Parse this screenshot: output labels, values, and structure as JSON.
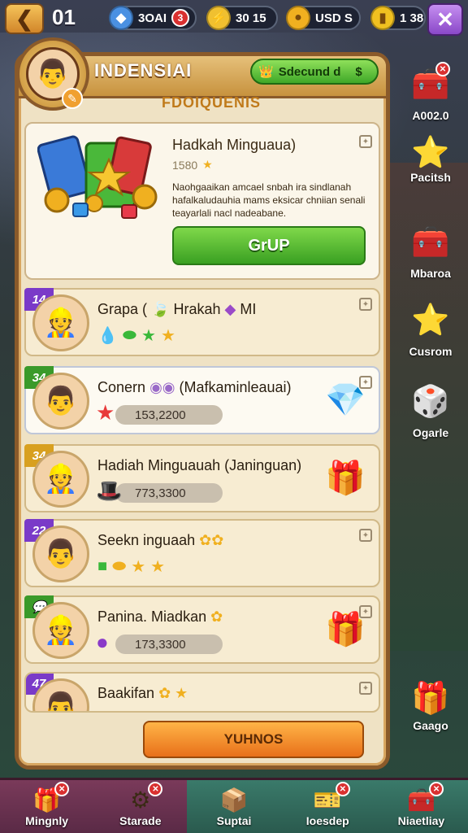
{
  "topbar": {
    "level": "01",
    "resources": [
      {
        "icon": "blue-gem-icon",
        "glyph": "◆",
        "color": "#4a90e2",
        "value": "3OAI",
        "badge": "3"
      },
      {
        "icon": "lightning-icon",
        "glyph": "⚡",
        "color": "#f0c030",
        "value": "30 15",
        "badge": ""
      },
      {
        "icon": "gold-coin-icon",
        "glyph": "●",
        "color": "#f0b020",
        "value": "USD S",
        "badge": ""
      },
      {
        "icon": "token-icon",
        "glyph": "▮",
        "color": "#f0c020",
        "value": "1 38",
        "badge": ""
      }
    ]
  },
  "panel": {
    "title": "INDENSIAI",
    "status_label": "Sdecund d",
    "status_value": "$",
    "subtitle": "FDOIQUENIS"
  },
  "featured": {
    "title": "Hadkah Minguaua)",
    "sub_value": "1580",
    "description": "Naohgaaikan amcael snbah ira sindlanah hafalkaludauhia mams eksicar chniian senali teayarlali nacl nadeabane.",
    "button": "GrUP"
  },
  "rows": [
    {
      "rank": "14",
      "rank_color": "#7a3ac8",
      "name": "Grapa (",
      "name_tail": "Hrakah",
      "name_tail2": "MI",
      "items": [
        "💧",
        "🟢",
        "★",
        "★"
      ],
      "value": "",
      "art": ""
    },
    {
      "rank": "34",
      "rank_color": "#3a9a2a",
      "name": "Conern",
      "name_tail": "(Mafkaminleauai)",
      "name_tail2": "",
      "items": [],
      "value": "153,2200",
      "val_icon": "★",
      "art": "💎"
    },
    {
      "rank": "34",
      "rank_color": "#d8a020",
      "name": "Hadiah Minguauah (Janinguan)",
      "name_tail": "",
      "name_tail2": "",
      "items": [],
      "value": "773,3300",
      "val_icon": "🎩",
      "art": "🎁"
    },
    {
      "rank": "22",
      "rank_color": "#7a3ac8",
      "name": "Seekn inguaah",
      "name_tail": "",
      "name_tail2": "",
      "items": [
        "🟩",
        "●",
        "★",
        "★"
      ],
      "value": "",
      "art": ""
    },
    {
      "rank": "",
      "rank_color": "#3a9a2a",
      "name": "Panina. Miadkan",
      "name_tail": "",
      "name_tail2": "",
      "items": [],
      "value": "173,3300",
      "val_icon": "🍆",
      "art": "🎁"
    },
    {
      "rank": "47",
      "rank_color": "#7a3ac8",
      "name": "Baakifan",
      "name_tail": "",
      "name_tail2": "",
      "items": [],
      "value": "",
      "art": ""
    }
  ],
  "cta": "YUHNOS",
  "sidebar": [
    {
      "icon": "gold-crate-icon",
      "glyph": "🧰",
      "label": "A002.0",
      "boxed": false,
      "badge": "x"
    },
    {
      "icon": "star-pen-icon",
      "glyph": "⭐",
      "label": "Pacitsh",
      "boxed": true,
      "badge": ""
    },
    {
      "icon": "gold-crate-icon",
      "glyph": "🧰",
      "label": "Mbaroa",
      "boxed": false,
      "badge": ""
    },
    {
      "icon": "star-icon",
      "glyph": "⭐",
      "label": "Cusrom",
      "boxed": false,
      "badge": ""
    },
    {
      "icon": "red-dice-icon",
      "glyph": "🎲",
      "label": "Ogarle",
      "boxed": false,
      "badge": ""
    },
    {
      "icon": "gift-box-icon",
      "glyph": "🎁",
      "label": "Gaago",
      "boxed": true,
      "badge": ""
    }
  ],
  "bottom_nav": [
    {
      "icon": "gift-stack-icon",
      "glyph": "🎁",
      "label": "Mingnly"
    },
    {
      "icon": "anvil-icon",
      "glyph": "⚙",
      "label": "Starade"
    },
    {
      "icon": "box-icon",
      "glyph": "📦",
      "label": "Suptai"
    },
    {
      "icon": "green-ticket-icon",
      "glyph": "🎫",
      "label": "Ioesdep"
    },
    {
      "icon": "gold-crate-icon",
      "glyph": "🧰",
      "label": "Niaetliay"
    }
  ]
}
